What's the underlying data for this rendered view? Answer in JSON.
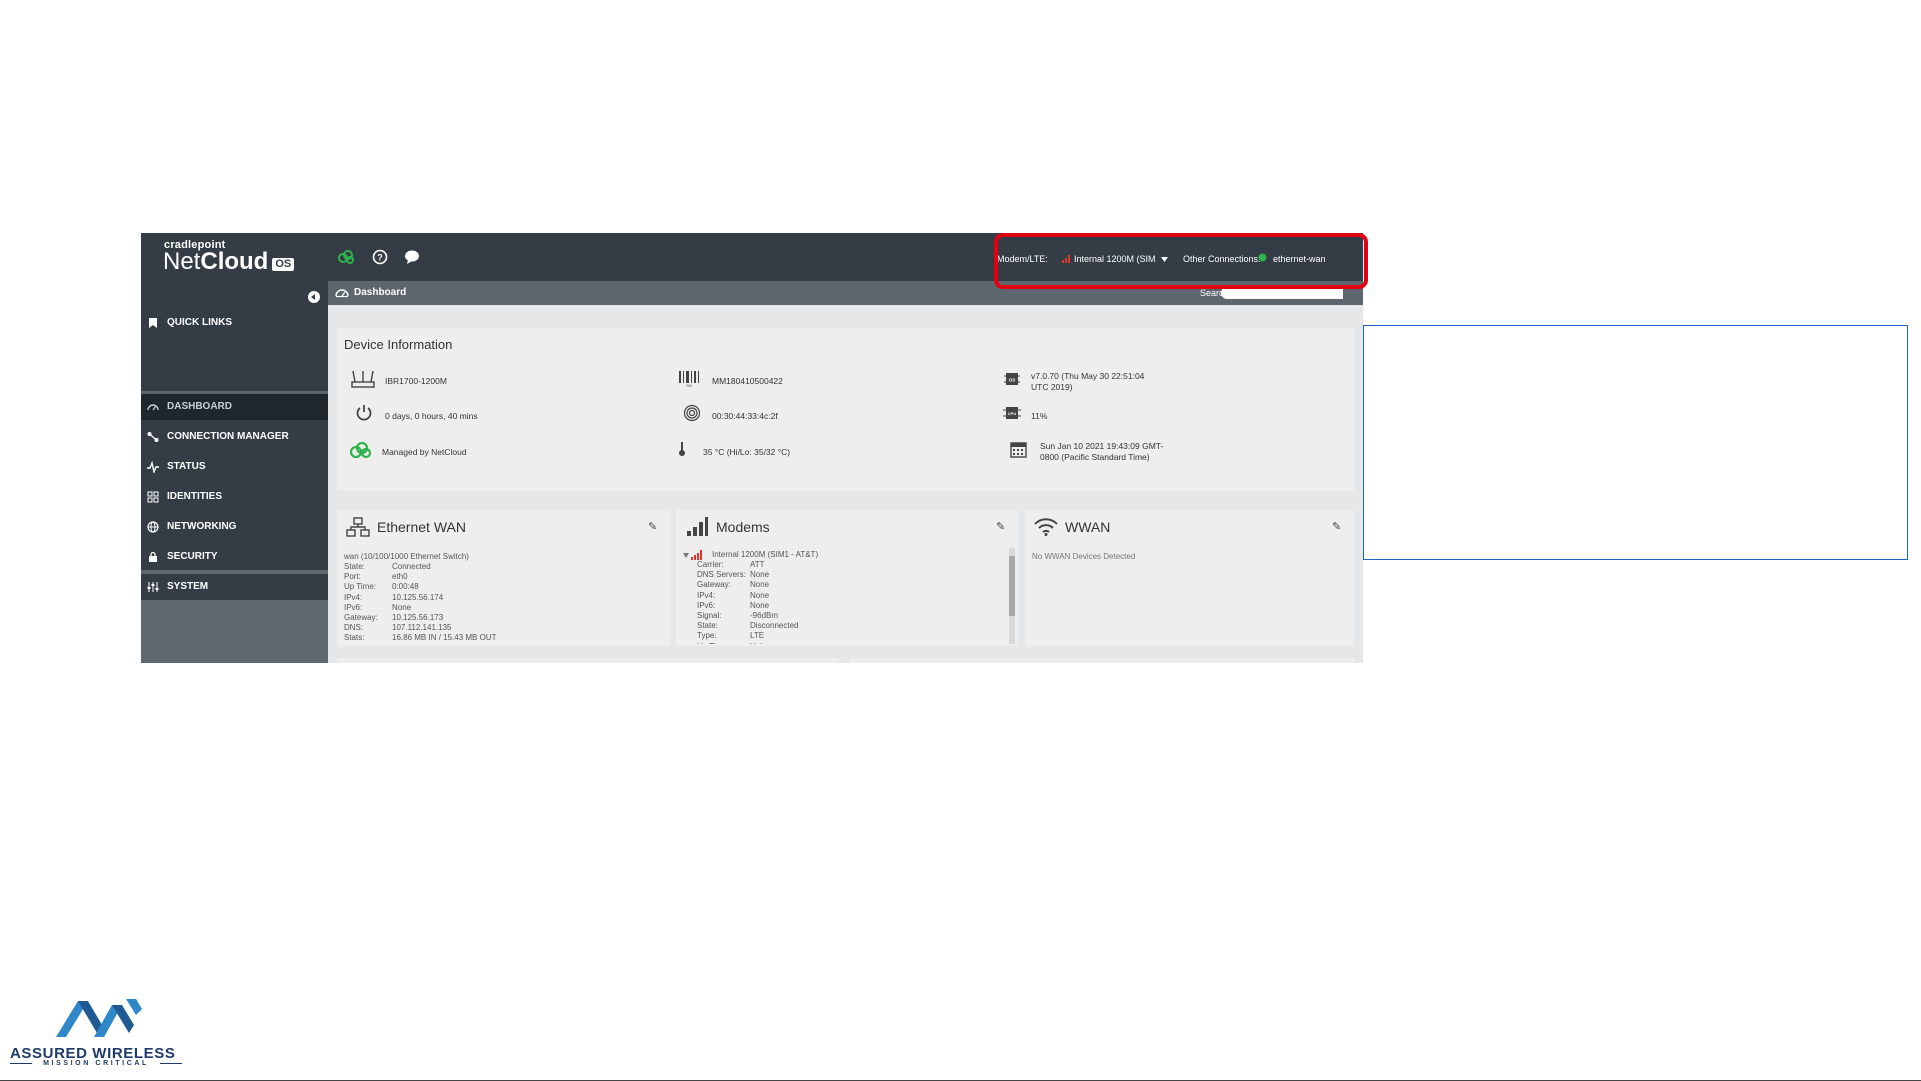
{
  "brand": {
    "company": "cradlepoint",
    "product_light": "Net",
    "product_bold": "Cloud",
    "os_badge": "OS"
  },
  "topbar": {
    "modem_label": "Modem/LTE:",
    "modem_value": "Internal 1200M (SIM",
    "other_label": "Other Connections:",
    "other_value": "ethernet-wan",
    "status_color": "#2db34a",
    "signal_color": "#e0342d"
  },
  "breadcrumb": {
    "label": "Dashboard"
  },
  "search": {
    "label": "Search",
    "placeholder": ""
  },
  "sidebar": {
    "items": [
      {
        "label": "QUICK LINKS",
        "icon": "bookmark-icon"
      },
      {
        "label": "DASHBOARD",
        "icon": "dashboard-icon",
        "active": true
      },
      {
        "label": "CONNECTION MANAGER",
        "icon": "connection-icon"
      },
      {
        "label": "STATUS",
        "icon": "pulse-icon"
      },
      {
        "label": "IDENTITIES",
        "icon": "grid-icon"
      },
      {
        "label": "NETWORKING",
        "icon": "globe-icon"
      },
      {
        "label": "SECURITY",
        "icon": "lock-icon"
      },
      {
        "label": "SYSTEM",
        "icon": "sliders-icon"
      }
    ]
  },
  "device_info": {
    "title": "Device Information",
    "model": "IBR1700-1200M",
    "serial": "MM180410500422",
    "firmware_line1": "v7.0.70 (Thu May 30 22:51:04",
    "firmware_line2": "UTC 2019)",
    "uptime": "0 days, 0 hours, 40 mins",
    "mac": "00:30:44:33:4c:2f",
    "cpu": "11%",
    "managed": "Managed by NetCloud",
    "temperature": "35 °C (Hi/Lo: 35/32 °C)",
    "datetime_line1": "Sun Jan 10 2021 19:43:09 GMT-",
    "datetime_line2": "0800 (Pacific Standard Time)"
  },
  "ethernet_wan": {
    "title": "Ethernet WAN",
    "header": "wan (10/100/1000 Ethernet Switch)",
    "rows": [
      {
        "k": "State:",
        "v": "Connected"
      },
      {
        "k": "Port:",
        "v": "eth0"
      },
      {
        "k": "Up Time:",
        "v": "0:00:48"
      },
      {
        "k": "IPv4:",
        "v": "10.125.56.174"
      },
      {
        "k": "IPv6:",
        "v": "None"
      },
      {
        "k": "Gateway:",
        "v": "10.125.56.173"
      },
      {
        "k": "DNS:",
        "v": "107.112.141.135"
      },
      {
        "k": "Stats:",
        "v": "16.86 MB IN / 15.43 MB OUT"
      }
    ]
  },
  "modems": {
    "title": "Modems",
    "header": "Internal 1200M (SIM1 - AT&T)",
    "rows": [
      {
        "k": "Carrier:",
        "v": "ATT"
      },
      {
        "k": "DNS Servers:",
        "v": "None"
      },
      {
        "k": "Gateway:",
        "v": "None"
      },
      {
        "k": "IPv4:",
        "v": "None"
      },
      {
        "k": "IPv6:",
        "v": "None"
      },
      {
        "k": "Signal:",
        "v": "-96dBm"
      },
      {
        "k": "State:",
        "v": "Disconnected"
      },
      {
        "k": "Type:",
        "v": "LTE"
      },
      {
        "k": "Up Time:",
        "v": "Unknown"
      }
    ]
  },
  "wwan": {
    "title": "WWAN",
    "message": "No WWAN Devices Detected"
  },
  "logo": {
    "name": "ASSURED WIRELESS",
    "tagline": "MISSION CRITICAL"
  }
}
